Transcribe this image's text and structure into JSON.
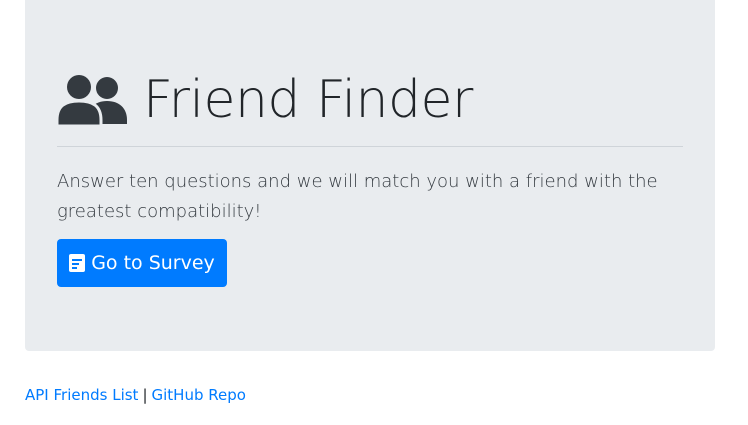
{
  "header": {
    "icon": "users-icon",
    "title": "Friend Finder"
  },
  "intro": {
    "text": "Answer ten questions and we will match you with a friend with the greatest compatibility!"
  },
  "survey_button": {
    "icon": "survey-document-icon",
    "label": "Go to Survey"
  },
  "footer": {
    "api_link": "API Friends List",
    "separator": "|",
    "github_link": "GitHub Repo"
  },
  "colors": {
    "jumbotron_bg": "#e9ecef",
    "primary": "#007bff",
    "text": "#212529"
  }
}
